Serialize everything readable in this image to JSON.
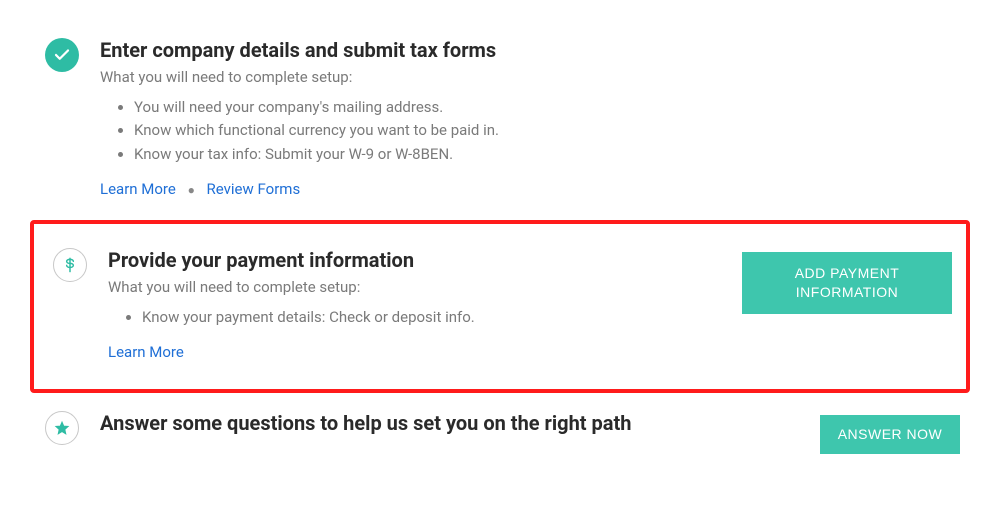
{
  "steps": [
    {
      "title": "Enter company details and submit tax forms",
      "subtitle": "What you will need to complete setup:",
      "items": [
        "You will need your company's mailing address.",
        "Know which functional currency you want to be paid in.",
        "Know your tax info: Submit your W-9 or W-8BEN."
      ],
      "learn_more": "Learn More",
      "review_forms": "Review Forms"
    },
    {
      "title": "Provide your payment information",
      "subtitle": "What you will need to complete setup:",
      "items": [
        "Know your payment details: Check or deposit info."
      ],
      "learn_more": "Learn More",
      "cta": "ADD PAYMENT INFORMATION"
    },
    {
      "title": "Answer some questions to help us set you on the right path",
      "cta": "ANSWER NOW"
    }
  ]
}
